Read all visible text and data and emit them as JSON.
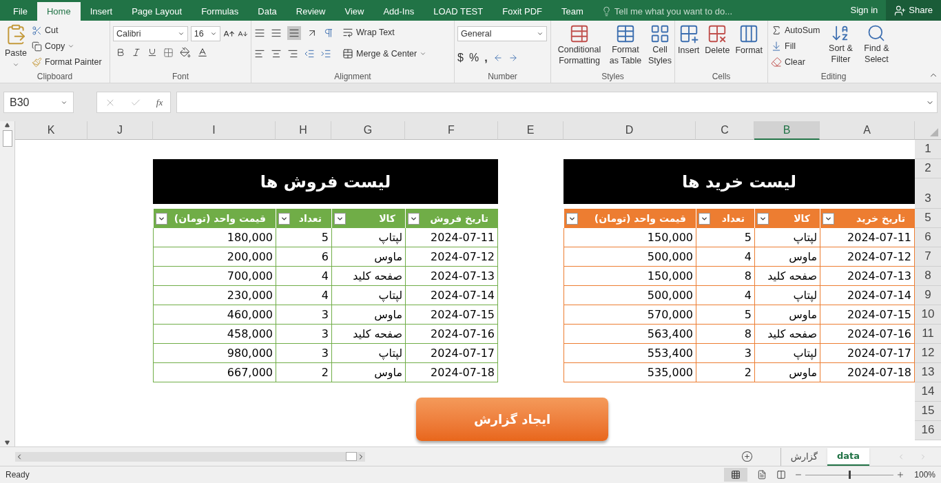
{
  "ribbon_tabs": [
    {
      "label": "File",
      "selected": false
    },
    {
      "label": "Home",
      "selected": true
    },
    {
      "label": "Insert",
      "selected": false
    },
    {
      "label": "Page Layout",
      "selected": false
    },
    {
      "label": "Formulas",
      "selected": false
    },
    {
      "label": "Data",
      "selected": false
    },
    {
      "label": "Review",
      "selected": false
    },
    {
      "label": "View",
      "selected": false
    },
    {
      "label": "Add-Ins",
      "selected": false
    },
    {
      "label": "LOAD TEST",
      "selected": false
    },
    {
      "label": "Foxit PDF",
      "selected": false
    },
    {
      "label": "Team",
      "selected": false
    }
  ],
  "tell_me": {
    "placeholder": "Tell me what you want to do..."
  },
  "sign_in": "Sign in",
  "share": "Share",
  "clipboard": {
    "paste": "Paste",
    "cut": "Cut",
    "copy": "Copy",
    "format_painter": "Format Painter",
    "label": "Clipboard"
  },
  "font": {
    "name": "Calibri",
    "size": "16",
    "label": "Font"
  },
  "alignment": {
    "wrap_text": "Wrap Text",
    "merge_center": "Merge & Center",
    "label": "Alignment"
  },
  "number": {
    "format": "General",
    "currency": "$",
    "percent": "%",
    "comma": ",",
    "label": "Number"
  },
  "styles": {
    "conditional_formatting": "Conditional Formatting",
    "format_as_table": "Format as Table",
    "cell_styles": "Cell Styles",
    "label": "Styles"
  },
  "cells": {
    "insert": "Insert",
    "delete": "Delete",
    "format": "Format",
    "label": "Cells"
  },
  "editing": {
    "autosum": "AutoSum",
    "fill": "Fill",
    "clear": "Clear",
    "sort_filter": "Sort & Filter",
    "find_select": "Find & Select",
    "label": "Editing"
  },
  "name_box": "B30",
  "function_button": "fx",
  "columns": [
    {
      "label": "K",
      "selected": false
    },
    {
      "label": "J",
      "selected": false
    },
    {
      "label": "I",
      "selected": false
    },
    {
      "label": "H",
      "selected": false
    },
    {
      "label": "G",
      "selected": false
    },
    {
      "label": "F",
      "selected": false
    },
    {
      "label": "E",
      "selected": false
    },
    {
      "label": "D",
      "selected": false
    },
    {
      "label": "C",
      "selected": false
    },
    {
      "label": "B",
      "selected": true
    },
    {
      "label": "A",
      "selected": false
    }
  ],
  "rows": [
    "1",
    "2",
    "3",
    "5",
    "6",
    "7",
    "8",
    "9",
    "10",
    "11",
    "12",
    "13",
    "14",
    "15",
    "16"
  ],
  "tables": [
    {
      "title": "لیست خرید ها",
      "color": "#ed7d31",
      "columns": [
        "قیمت واحد (تومان)",
        "تعداد",
        "کالا",
        "تاریخ خرید"
      ],
      "rows": [
        [
          "150,000",
          "5",
          "لپتاپ",
          "2024-07-11"
        ],
        [
          "500,000",
          "4",
          "ماوس",
          "2024-07-12"
        ],
        [
          "150,000",
          "8",
          "صفحه کلید",
          "2024-07-13"
        ],
        [
          "500,000",
          "4",
          "لپتاپ",
          "2024-07-14"
        ],
        [
          "570,000",
          "5",
          "ماوس",
          "2024-07-15"
        ],
        [
          "563,400",
          "8",
          "صفحه کلید",
          "2024-07-16"
        ],
        [
          "553,400",
          "3",
          "لپتاپ",
          "2024-07-17"
        ],
        [
          "535,000",
          "2",
          "ماوس",
          "2024-07-18"
        ]
      ]
    },
    {
      "title": "لیست فروش ها",
      "color": "#70ad47",
      "columns": [
        "قیمت واحد (تومان)",
        "تعداد",
        "کالا",
        "تاریخ فروش"
      ],
      "rows": [
        [
          "180,000",
          "5",
          "لپتاپ",
          "2024-07-11"
        ],
        [
          "200,000",
          "6",
          "ماوس",
          "2024-07-12"
        ],
        [
          "700,000",
          "4",
          "صفحه کلید",
          "2024-07-13"
        ],
        [
          "230,000",
          "4",
          "لپتاپ",
          "2024-07-14"
        ],
        [
          "460,000",
          "3",
          "ماوس",
          "2024-07-15"
        ],
        [
          "458,000",
          "3",
          "صفحه کلید",
          "2024-07-16"
        ],
        [
          "980,000",
          "3",
          "لپتاپ",
          "2024-07-17"
        ],
        [
          "667,000",
          "2",
          "ماوس",
          "2024-07-18"
        ]
      ]
    }
  ],
  "report_button": "ایجاد گزارش",
  "sheet_tabs": [
    {
      "label": "گزارش",
      "selected": false
    },
    {
      "label": "data",
      "selected": true
    }
  ],
  "status": "Ready",
  "zoom_slider": {
    "level": 0.5
  },
  "zoom": "100%"
}
